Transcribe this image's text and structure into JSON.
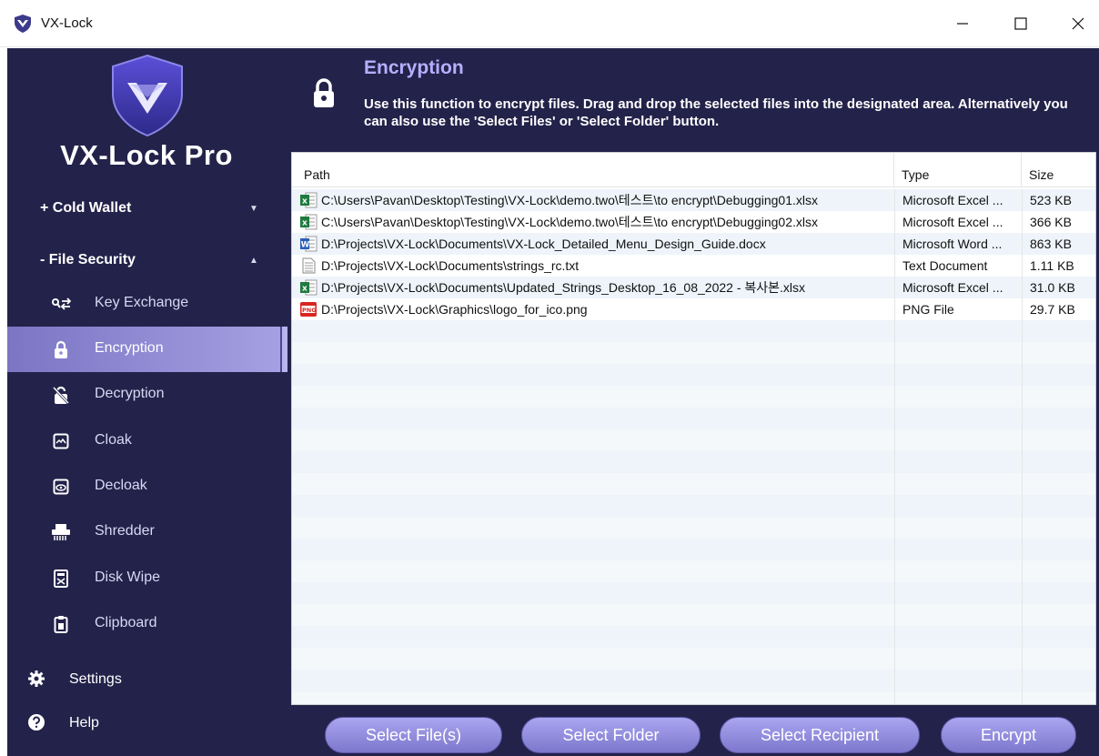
{
  "window": {
    "title": "VX-Lock",
    "minimize_glyph": "—",
    "maximize_glyph": "☐",
    "close_glyph": "✕"
  },
  "sidebar": {
    "brand": "VX-Lock Pro",
    "groups": [
      {
        "label": "+ Cold Wallet",
        "caret": "▼"
      },
      {
        "label": "-  File Security",
        "caret": "▲"
      }
    ],
    "items": [
      {
        "label": "Key Exchange",
        "icon": "key-exchange-icon"
      },
      {
        "label": "Encryption",
        "icon": "lock-icon",
        "active": true
      },
      {
        "label": "Decryption",
        "icon": "unlock-icon"
      },
      {
        "label": "Cloak",
        "icon": "cloak-icon"
      },
      {
        "label": "Decloak",
        "icon": "decloak-icon"
      },
      {
        "label": "Shredder",
        "icon": "shredder-icon"
      },
      {
        "label": "Disk Wipe",
        "icon": "disk-wipe-icon"
      },
      {
        "label": "Clipboard",
        "icon": "clipboard-icon"
      }
    ],
    "bottom": [
      {
        "label": "Settings",
        "icon": "gear-icon"
      },
      {
        "label": "Help",
        "icon": "help-icon"
      }
    ]
  },
  "header": {
    "title": "Encryption",
    "description": "Use this function to encrypt files.  Drag and drop the selected files into the designated area.  Alternatively you can also use the 'Select Files' or 'Select Folder' button."
  },
  "file_list": {
    "columns": [
      "Path",
      "Type",
      "Size"
    ],
    "rows": [
      {
        "path": "C:\\Users\\Pavan\\Desktop\\Testing\\VX-Lock\\demo.two\\테스트\\to encrypt\\Debugging01.xlsx",
        "type": "Microsoft Excel ...",
        "size": "523 KB",
        "icon": "excel-file-icon"
      },
      {
        "path": "C:\\Users\\Pavan\\Desktop\\Testing\\VX-Lock\\demo.two\\테스트\\to encrypt\\Debugging02.xlsx",
        "type": "Microsoft Excel ...",
        "size": "366 KB",
        "icon": "excel-file-icon"
      },
      {
        "path": "D:\\Projects\\VX-Lock\\Documents\\VX-Lock_Detailed_Menu_Design_Guide.docx",
        "type": "Microsoft Word ...",
        "size": "863 KB",
        "icon": "word-file-icon"
      },
      {
        "path": "D:\\Projects\\VX-Lock\\Documents\\strings_rc.txt",
        "type": "Text Document",
        "size": "1.11 KB",
        "icon": "text-file-icon"
      },
      {
        "path": "D:\\Projects\\VX-Lock\\Documents\\Updated_Strings_Desktop_16_08_2022 - 복사본.xlsx",
        "type": "Microsoft Excel ...",
        "size": "31.0 KB",
        "icon": "excel-file-icon"
      },
      {
        "path": "D:\\Projects\\VX-Lock\\Graphics\\logo_for_ico.png",
        "type": "PNG File",
        "size": "29.7 KB",
        "icon": "png-file-icon"
      }
    ]
  },
  "buttons": {
    "select_files": "Select File(s)",
    "select_folder": "Select Folder",
    "select_recipient": "Select Recipient",
    "encrypt": "Encrypt"
  },
  "colors": {
    "sidebar_bg": "#23224a",
    "accent_title": "#b4b0ff",
    "active_item": "#8e89d8",
    "button": "#9591e2"
  }
}
